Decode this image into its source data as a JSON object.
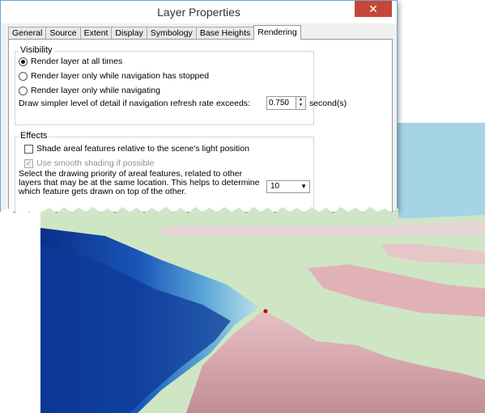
{
  "window": {
    "title": "Layer Properties",
    "close_glyph": "✕"
  },
  "tabs": [
    {
      "label": "General"
    },
    {
      "label": "Source"
    },
    {
      "label": "Extent"
    },
    {
      "label": "Display"
    },
    {
      "label": "Symbology"
    },
    {
      "label": "Base Heights"
    },
    {
      "label": "Rendering",
      "active": true
    }
  ],
  "visibility": {
    "group_label": "Visibility",
    "options": [
      {
        "label": "Render layer at all times",
        "selected": true
      },
      {
        "label": "Render layer only while navigation has stopped",
        "selected": false
      },
      {
        "label": "Render layer only while navigating",
        "selected": false
      }
    ],
    "refresh_label": "Draw simpler level of detail if navigation refresh rate exceeds:",
    "refresh_value": "0.750",
    "refresh_unit": "second(s)"
  },
  "effects": {
    "group_label": "Effects",
    "shade_label": "Shade areal features relative to the scene's light position",
    "shade_checked": false,
    "smooth_label": "Use smooth shading if possible",
    "smooth_checked": true,
    "priority_text": "Select the drawing priority of areal features, related to other layers that may be at the same location. This helps to determine which feature gets drawn on top of the other.",
    "priority_value": "10"
  },
  "colors": {
    "sky": "#a4d4e6",
    "land_green": "#cfe6c4",
    "land_pink": "#e0b2b7",
    "water_deep": "#0e3d9a",
    "water_light": "#b9e1ea",
    "close_button": "#c7463b"
  }
}
